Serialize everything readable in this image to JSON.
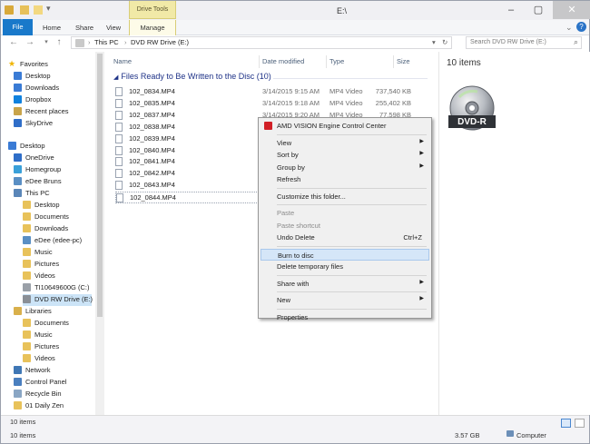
{
  "window": {
    "title": "E:\\",
    "drive_tools_label": "Drive Tools",
    "controls": {
      "minimize": "–",
      "maximize": "▢",
      "close": "✕"
    }
  },
  "ribbon": {
    "tabs": [
      {
        "label": "File"
      },
      {
        "label": "Home"
      },
      {
        "label": "Share"
      },
      {
        "label": "View"
      },
      {
        "label": "Manage"
      }
    ],
    "help_icon": "?"
  },
  "address": {
    "path": [
      "This PC",
      "DVD RW Drive (E:)"
    ],
    "search_placeholder": "Search DVD RW Drive (E:)"
  },
  "nav": {
    "items": [
      {
        "label": "Favorites",
        "icon": "star-icon",
        "indent": 0
      },
      {
        "label": "Desktop",
        "icon": "desktop-icon",
        "indent": 1
      },
      {
        "label": "Downloads",
        "icon": "downloads-icon",
        "indent": 1
      },
      {
        "label": "Dropbox",
        "icon": "dropbox-icon",
        "indent": 1
      },
      {
        "label": "Recent places",
        "icon": "recent-icon",
        "indent": 1
      },
      {
        "label": "SkyDrive",
        "icon": "cloud-icon",
        "indent": 1
      },
      {
        "label": "Desktop",
        "icon": "desktop-icon",
        "indent": 0
      },
      {
        "label": "OneDrive",
        "icon": "cloud-icon",
        "indent": 1
      },
      {
        "label": "Homegroup",
        "icon": "homegroup-icon",
        "indent": 1
      },
      {
        "label": "eDee Bruns",
        "icon": "user-icon",
        "indent": 1
      },
      {
        "label": "This PC",
        "icon": "computer-icon",
        "indent": 1
      },
      {
        "label": "Desktop",
        "icon": "folder-icon",
        "indent": 2
      },
      {
        "label": "Documents",
        "icon": "folder-icon",
        "indent": 2
      },
      {
        "label": "Downloads",
        "icon": "folder-icon",
        "indent": 2
      },
      {
        "label": "eDee (edee-pc)",
        "icon": "user-icon",
        "indent": 2
      },
      {
        "label": "Music",
        "icon": "music-icon",
        "indent": 2
      },
      {
        "label": "Pictures",
        "icon": "folder-icon",
        "indent": 2
      },
      {
        "label": "Videos",
        "icon": "folder-icon",
        "indent": 2
      },
      {
        "label": "TI10649600G (C:)",
        "icon": "drive-icon",
        "indent": 2
      },
      {
        "label": "DVD RW Drive (E:)",
        "icon": "dvd-drive-icon",
        "indent": 2
      },
      {
        "label": "Libraries",
        "icon": "library-icon",
        "indent": 1
      },
      {
        "label": "Documents",
        "icon": "folder-icon",
        "indent": 2
      },
      {
        "label": "Music",
        "icon": "music-icon",
        "indent": 2
      },
      {
        "label": "Pictures",
        "icon": "folder-icon",
        "indent": 2
      },
      {
        "label": "Videos",
        "icon": "folder-icon",
        "indent": 2
      },
      {
        "label": "Network",
        "icon": "network-icon",
        "indent": 1
      },
      {
        "label": "Control Panel",
        "icon": "control-panel-icon",
        "indent": 1
      },
      {
        "label": "Recycle Bin",
        "icon": "recycle-bin-icon",
        "indent": 1
      },
      {
        "label": "01 Daily Zen",
        "icon": "folder-icon",
        "indent": 1
      }
    ],
    "footer_count": "10 items"
  },
  "columns": {
    "name": "Name",
    "date": "Date modified",
    "type": "Type",
    "size": "Size"
  },
  "group_label": "Files Ready to Be Written to the Disc (10)",
  "files": [
    {
      "name": "102_0834.MP4",
      "date": "3/14/2015 9:15 AM",
      "type": "MP4 Video",
      "size": "737,540 KB"
    },
    {
      "name": "102_0835.MP4",
      "date": "3/14/2015 9:18 AM",
      "type": "MP4 Video",
      "size": "255,402 KB"
    },
    {
      "name": "102_0837.MP4",
      "date": "3/14/2015 9:20 AM",
      "type": "MP4 Video",
      "size": "77,598 KB"
    },
    {
      "name": "102_0838.MP4",
      "date": "",
      "type": "",
      "size": ""
    },
    {
      "name": "102_0839.MP4",
      "date": "",
      "type": "",
      "size": ""
    },
    {
      "name": "102_0840.MP4",
      "date": "",
      "type": "",
      "size": ""
    },
    {
      "name": "102_0841.MP4",
      "date": "",
      "type": "",
      "size": ""
    },
    {
      "name": "102_0842.MP4",
      "date": "",
      "type": "",
      "size": ""
    },
    {
      "name": "102_0843.MP4",
      "date": "",
      "type": "",
      "size": ""
    },
    {
      "name": "102_0844.MP4",
      "date": "",
      "type": "",
      "size": ""
    }
  ],
  "preview": {
    "count": "10 items",
    "disc_label": "DVD-R"
  },
  "context_menu": {
    "items": [
      {
        "label": "AMD VISION Engine Control Center",
        "icon": "amd-icon",
        "disabled": false,
        "arrow": false,
        "shortcut": ""
      },
      {
        "sep": true
      },
      {
        "label": "View",
        "arrow": true
      },
      {
        "label": "Sort by",
        "arrow": true
      },
      {
        "label": "Group by",
        "arrow": true
      },
      {
        "label": "Refresh"
      },
      {
        "sep": true
      },
      {
        "label": "Customize this folder..."
      },
      {
        "sep": true
      },
      {
        "label": "Paste",
        "disabled": true
      },
      {
        "label": "Paste shortcut",
        "disabled": true
      },
      {
        "label": "Undo Delete",
        "shortcut": "Ctrl+Z"
      },
      {
        "sep": true
      },
      {
        "label": "Burn to disc",
        "highlighted": true
      },
      {
        "label": "Delete temporary files"
      },
      {
        "sep": true
      },
      {
        "label": "Share with",
        "arrow": true
      },
      {
        "sep": true
      },
      {
        "label": "New",
        "arrow": true
      },
      {
        "sep": true
      },
      {
        "label": "Properties"
      }
    ]
  },
  "status": {
    "count": "10 items",
    "free": "3.57 GB",
    "location": "Computer"
  }
}
